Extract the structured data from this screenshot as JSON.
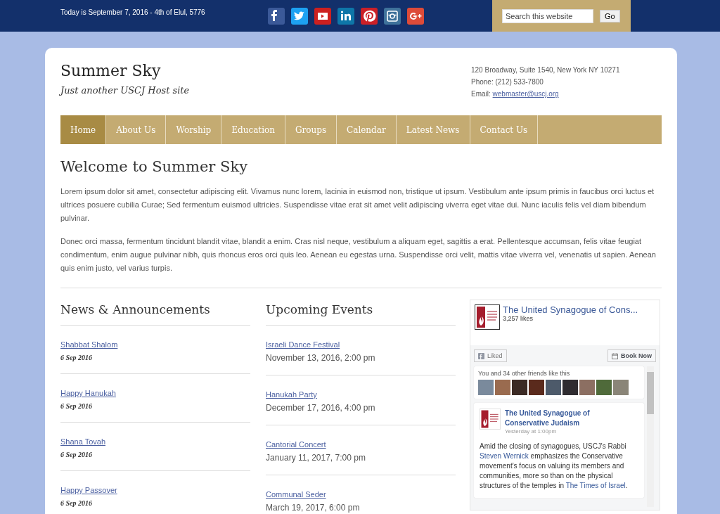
{
  "top_bar": {
    "date_text": "Today is September 7, 2016 - 4th of Elul, 5776",
    "social": [
      {
        "kind": "facebook",
        "color": "#3b5998"
      },
      {
        "kind": "twitter",
        "color": "#1da1f2"
      },
      {
        "kind": "youtube",
        "color": "#cd201f"
      },
      {
        "kind": "linkedin",
        "color": "#0e76a8"
      },
      {
        "kind": "pinterest",
        "color": "#cb2027"
      },
      {
        "kind": "instagram",
        "color": "#3f729b"
      },
      {
        "kind": "googleplus",
        "color": "#dd4b39"
      }
    ],
    "search": {
      "placeholder": "Search this website",
      "button": "Go"
    }
  },
  "header": {
    "site_title": "Summer Sky",
    "tagline": "Just another USCJ Host site",
    "address": "120 Broadway, Suite 1540, New York NY 10271",
    "phone": "Phone: (212) 533-7800",
    "email_label": "Email:",
    "email": "webmaster@uscj.org"
  },
  "nav": [
    {
      "label": "Home",
      "selected": true
    },
    {
      "label": "About Us",
      "selected": false
    },
    {
      "label": "Worship",
      "selected": false
    },
    {
      "label": "Education",
      "selected": false
    },
    {
      "label": "Groups",
      "selected": false
    },
    {
      "label": "Calendar",
      "selected": false
    },
    {
      "label": "Latest News",
      "selected": false
    },
    {
      "label": "Contact Us",
      "selected": false
    }
  ],
  "main": {
    "title": "Welcome to Summer Sky",
    "paragraphs": [
      "Lorem ipsum dolor sit amet, consectetur adipiscing elit. Vivamus nunc lorem, lacinia in euismod non, tristique ut ipsum. Vestibulum ante ipsum primis in faucibus orci luctus et ultrices posuere cubilia Curae; Sed fermentum euismod ultricies. Suspendisse vitae erat sit amet velit adipiscing viverra eget vitae dui. Nunc iaculis felis vel diam bibendum pulvinar.",
      "Donec orci massa, fermentum tincidunt blandit vitae, blandit a enim. Cras nisl neque, vestibulum a aliquam eget, sagittis a erat. Pellentesque accumsan, felis vitae feugiat condimentum, enim augue pulvinar nibh, quis rhoncus eros orci quis leo. Aenean eu egestas urna. Suspendisse orci velit, mattis vitae viverra vel, venenatis ut sapien. Aenean quis enim justo, vel varius turpis."
    ]
  },
  "news": {
    "title": "News & Announcements",
    "items": [
      {
        "title": "Shabbat Shalom",
        "date": "6 Sep 2016"
      },
      {
        "title": "Happy Hanukah",
        "date": "6 Sep 2016"
      },
      {
        "title": "Shana Tovah",
        "date": "6 Sep 2016"
      },
      {
        "title": "Happy Passover",
        "date": "6 Sep 2016"
      }
    ]
  },
  "events": {
    "title": "Upcoming Events",
    "items": [
      {
        "title": "Israeli Dance Festival",
        "date": "November 13, 2016, 2:00 pm"
      },
      {
        "title": "Hanukah Party",
        "date": "December 17, 2016, 4:00 pm"
      },
      {
        "title": "Cantorial Concert",
        "date": "January 11, 2017, 7:00 pm"
      },
      {
        "title": "Communal Seder",
        "date": "March 19, 2017, 6:00 pm"
      }
    ]
  },
  "facebook": {
    "page_name": "The United Synagogue of Cons...",
    "likes": "3,257 likes",
    "liked_button": "Liked",
    "book_button": "Book Now",
    "friends_text": "You and 34 other friends like this",
    "post": {
      "author": "The United Synagogue of Conservative Judaism",
      "time": "Yesterday at 1:00pm",
      "text": [
        {
          "kind": "text",
          "text": "Amid the closing of synagogues, USCJ's Rabbi "
        },
        {
          "kind": "link",
          "text": "Steven Wernick"
        },
        {
          "kind": "text",
          "text": " emphasizes the Conservative movement's focus on valuing its members and communities, more so than on the physical structures of the temples in "
        },
        {
          "kind": "link",
          "text": "The Times of Israel"
        },
        {
          "kind": "text",
          "text": "."
        }
      ]
    }
  }
}
